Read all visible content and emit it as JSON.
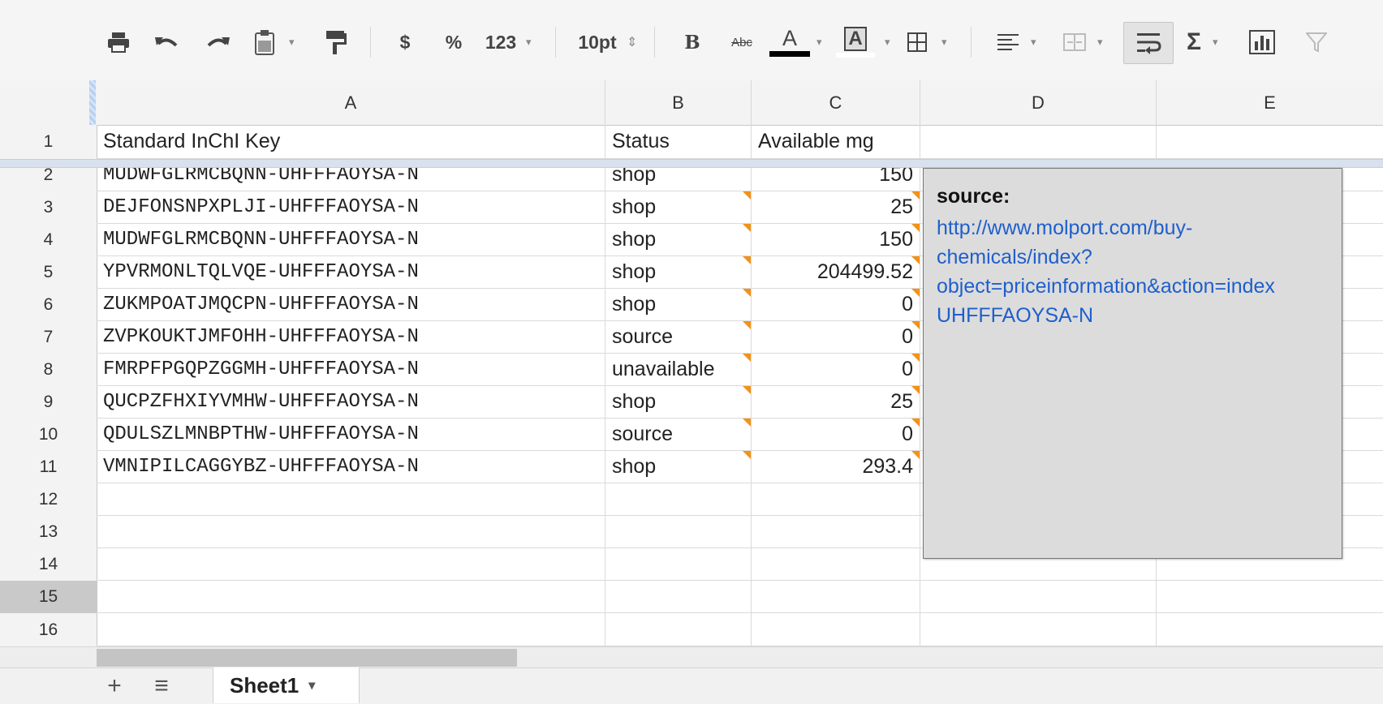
{
  "toolbar": {
    "currency_label": "$",
    "percent_label": "%",
    "number_format_label": "123",
    "font_size_label": "10pt",
    "font_size_arrows": "⇕",
    "bold_label": "B",
    "strike_label": "Abc",
    "text_color_label": "A",
    "fill_color_label": "A",
    "sigma_label": "Σ",
    "caret": "▾"
  },
  "columns": [
    "A",
    "B",
    "C",
    "D",
    "E"
  ],
  "rows": [
    {
      "num": "1",
      "a": "Standard InChI Key",
      "b": "Status",
      "c": "Available mg"
    },
    {
      "num": "2",
      "a": "MUDWFGLRMCBQNN-UHFFFAOYSA-N",
      "b": "shop",
      "c": "150"
    },
    {
      "num": "3",
      "a": "DEJFONSNPXPLJI-UHFFFAOYSA-N",
      "b": "shop",
      "c": "25"
    },
    {
      "num": "4",
      "a": "MUDWFGLRMCBQNN-UHFFFAOYSA-N",
      "b": "shop",
      "c": "150"
    },
    {
      "num": "5",
      "a": "YPVRMONLTQLVQE-UHFFFAOYSA-N",
      "b": "shop",
      "c": "204499.52"
    },
    {
      "num": "6",
      "a": "ZUKMPOATJMQCPN-UHFFFAOYSA-N",
      "b": "shop",
      "c": "0"
    },
    {
      "num": "7",
      "a": "ZVPKOUKTJMFOHH-UHFFFAOYSA-N",
      "b": "source",
      "c": "0"
    },
    {
      "num": "8",
      "a": "FMRPFPGQPZGGMH-UHFFFAOYSA-N",
      "b": "unavailable",
      "c": "0"
    },
    {
      "num": "9",
      "a": "QUCPZFHXIYVMHW-UHFFFAOYSA-N",
      "b": "shop",
      "c": "25"
    },
    {
      "num": "10",
      "a": "QDULSZLMNBPTHW-UHFFFAOYSA-N",
      "b": "source",
      "c": "0"
    },
    {
      "num": "11",
      "a": "VMNIPILCAGGYBZ-UHFFFAOYSA-N",
      "b": "shop",
      "c": "293.4"
    },
    {
      "num": "12",
      "a": "",
      "b": "",
      "c": ""
    },
    {
      "num": "13",
      "a": "",
      "b": "",
      "c": ""
    },
    {
      "num": "14",
      "a": "",
      "b": "",
      "c": ""
    },
    {
      "num": "15",
      "a": "",
      "b": "",
      "c": ""
    },
    {
      "num": "16",
      "a": "",
      "b": "",
      "c": ""
    }
  ],
  "selected_row": "15",
  "note": {
    "author": "source:",
    "link_text": "http://www.molport.com/buy-\nchemicals/index?\nobject=priceinformation&action=index\nUHFFFAOYSA-N"
  },
  "sheet": {
    "add_label": "+",
    "list_label": "≡",
    "tab_name": "Sheet1",
    "tab_arrow": "▾"
  },
  "colors": {
    "note_marker": "#f29219",
    "link": "#1f5fcc",
    "note_bg": "#dcdcdc"
  }
}
